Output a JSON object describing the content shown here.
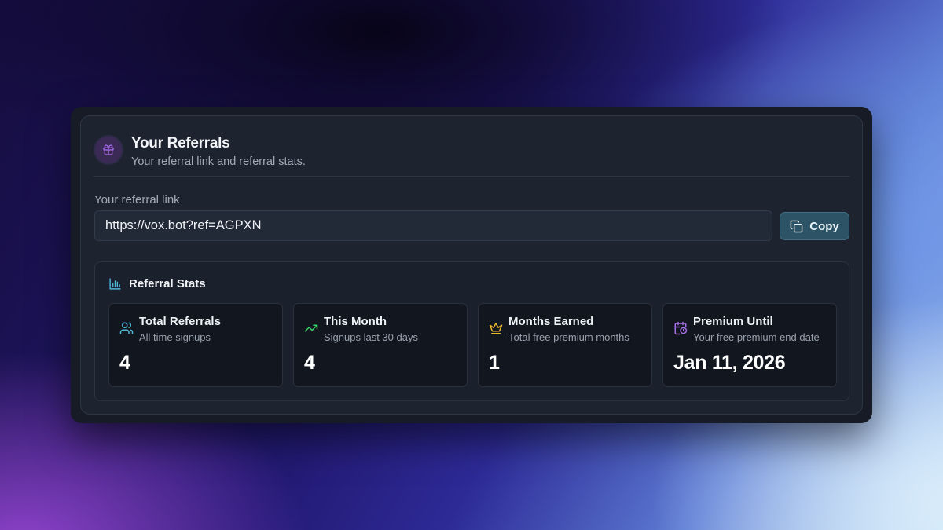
{
  "header": {
    "title": "Your Referrals",
    "subtitle": "Your referral link and referral stats."
  },
  "link": {
    "label": "Your referral link",
    "value": "https://vox.bot?ref=AGPXN",
    "copy_label": "Copy"
  },
  "stats": {
    "title": "Referral Stats",
    "tiles": [
      {
        "title": "Total Referrals",
        "subtitle": "All time signups",
        "value": "4",
        "icon": "users-icon"
      },
      {
        "title": "This Month",
        "subtitle": "Signups last 30 days",
        "value": "4",
        "icon": "trending-up-icon"
      },
      {
        "title": "Months Earned",
        "subtitle": "Total free premium months",
        "value": "1",
        "icon": "crown-icon"
      },
      {
        "title": "Premium Until",
        "subtitle": "Your free premium end date",
        "value": "Jan 11, 2026",
        "icon": "calendar-clock-icon"
      }
    ]
  },
  "colors": {
    "gift_icon": "#a66ee8",
    "chart_icon": "#4fb6d8",
    "users_icon": "#4fb6d8",
    "trend_icon": "#3ecf6a",
    "crown_icon": "#e8b92a",
    "calendar_icon": "#a66ee8",
    "copy_button": "#2d5366"
  }
}
